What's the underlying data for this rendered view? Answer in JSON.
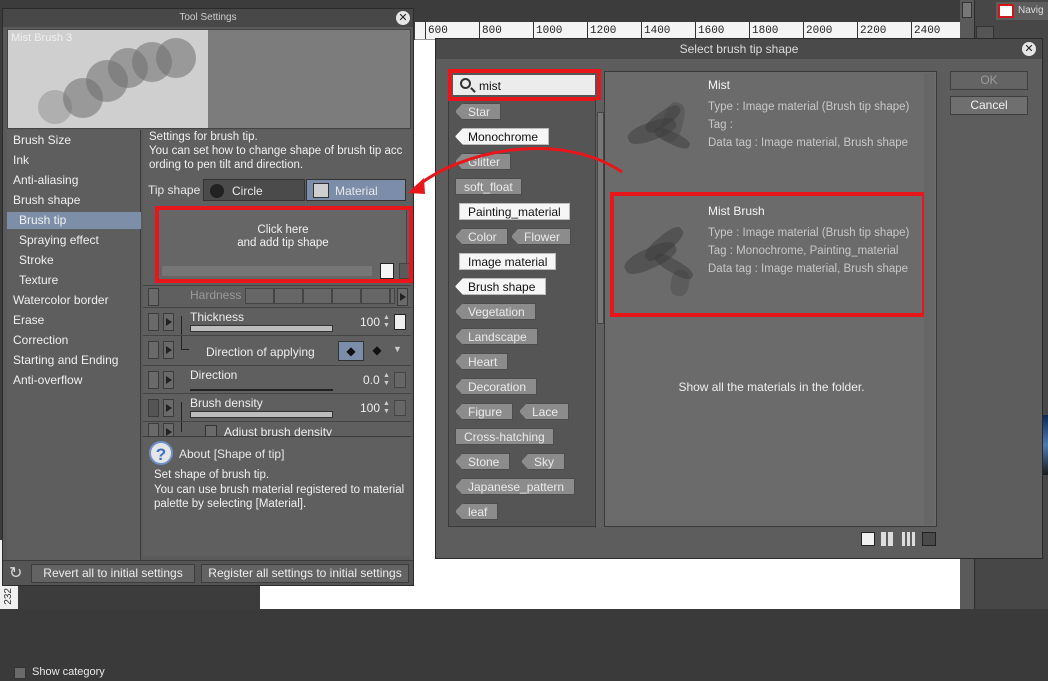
{
  "ruler": {
    "ticks": [
      "600",
      "800",
      "1000",
      "1200",
      "1400",
      "1600",
      "1800",
      "2000",
      "2200",
      "2400"
    ]
  },
  "left_ruler_label": "232",
  "navigator": {
    "label": "Navig"
  },
  "tool_settings": {
    "title": "Tool Settings",
    "brush_name": "Mist Brush 3",
    "categories": [
      {
        "label": "Brush Size"
      },
      {
        "label": "Ink"
      },
      {
        "label": "Anti-aliasing"
      },
      {
        "label": "Brush shape"
      },
      {
        "label": "Brush tip"
      },
      {
        "label": "Spraying effect"
      },
      {
        "label": "Stroke"
      },
      {
        "label": "Texture"
      },
      {
        "label": "Watercolor border"
      },
      {
        "label": "Erase"
      },
      {
        "label": "Correction"
      },
      {
        "label": "Starting and Ending"
      },
      {
        "label": "Anti-overflow"
      }
    ],
    "show_category": "Show category",
    "description": "Settings for brush tip.\nYou can set how to change shape of brush tip acc ording to pen tilt and direction.",
    "tip_shape_label": "Tip shape",
    "tip_circle": "Circle",
    "tip_material": "Material",
    "add_tip": "Click here\nand add tip shape",
    "params": {
      "hardness": "Hardness",
      "thickness": "Thickness",
      "thickness_value": "100",
      "direction_of_applying": "Direction of applying",
      "direction": "Direction",
      "direction_value": "0.0",
      "brush_density": "Brush density",
      "brush_density_value": "100",
      "adjust_brush_density": "Adjust brush density"
    },
    "about_title": "About [Shape of tip]",
    "about_body": "Set shape of brush tip.\nYou can use brush material registered to material palette by selecting [Material].",
    "revert_button": "Revert all to initial settings",
    "register_button": "Register all settings to initial settings"
  },
  "dialog": {
    "title": "Select brush tip shape",
    "search_value": "mist",
    "tags": [
      "Star",
      "Monochrome",
      "Glitter",
      "soft_float",
      "Painting_material",
      "Color",
      "Flower",
      "Image material",
      "Brush shape",
      "Vegetation",
      "Landscape",
      "Heart",
      "Decoration",
      "Figure",
      "Lace",
      "Cross-hatching",
      "Stone",
      "Sky",
      "Japanese_pattern",
      "leaf"
    ],
    "materials": [
      {
        "name": "Mist",
        "type": "Type : Image material (Brush tip shape)",
        "tag": "Tag :",
        "data_tag": "Data tag : Image material, Brush shape"
      },
      {
        "name": "Mist Brush",
        "type": "Type : Image material (Brush tip shape)",
        "tag": "Tag : Monochrome, Painting_material",
        "data_tag": "Data tag : Image material, Brush shape"
      }
    ],
    "footer": "Show all the materials in the folder.",
    "ok": "OK",
    "cancel": "Cancel"
  },
  "colors": {
    "highlight": "#e8161a",
    "selection": "#7d8fa8"
  }
}
